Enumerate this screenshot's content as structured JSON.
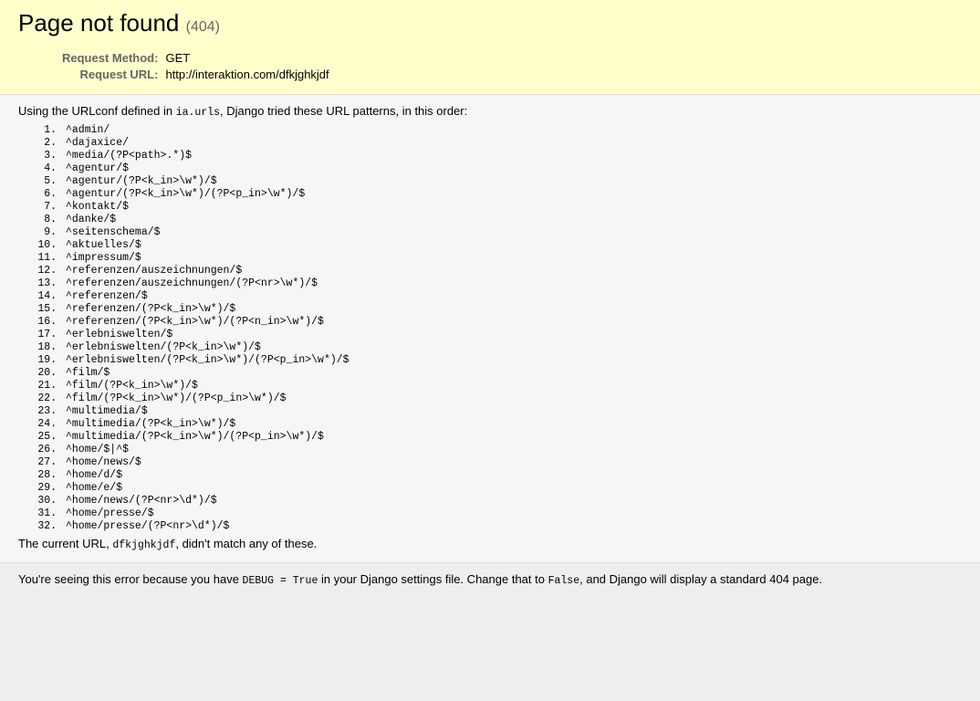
{
  "summary": {
    "title": "Page not found",
    "status_code": "(404)",
    "request_method_label": "Request Method:",
    "request_method": "GET",
    "request_url_label": "Request URL:",
    "request_url": "http://interaktion.com/dfkjghkjdf"
  },
  "info": {
    "intro_before": "Using the URLconf defined in ",
    "urlconf": "ia.urls",
    "intro_after": ", Django tried these URL patterns, in this order:",
    "patterns": [
      "^admin/",
      "^dajaxice/",
      "^media/(?P<path>.*)$",
      "^agentur/$",
      "^agentur/(?P<k_in>\\w*)/$",
      "^agentur/(?P<k_in>\\w*)/(?P<p_in>\\w*)/$",
      "^kontakt/$",
      "^danke/$",
      "^seitenschema/$",
      "^aktuelles/$",
      "^impressum/$",
      "^referenzen/auszeichnungen/$",
      "^referenzen/auszeichnungen/(?P<nr>\\w*)/$",
      "^referenzen/$",
      "^referenzen/(?P<k_in>\\w*)/$",
      "^referenzen/(?P<k_in>\\w*)/(?P<n_in>\\w*)/$",
      "^erlebniswelten/$",
      "^erlebniswelten/(?P<k_in>\\w*)/$",
      "^erlebniswelten/(?P<k_in>\\w*)/(?P<p_in>\\w*)/$",
      "^film/$",
      "^film/(?P<k_in>\\w*)/$",
      "^film/(?P<k_in>\\w*)/(?P<p_in>\\w*)/$",
      "^multimedia/$",
      "^multimedia/(?P<k_in>\\w*)/$",
      "^multimedia/(?P<k_in>\\w*)/(?P<p_in>\\w*)/$",
      "^home/$|^$",
      "^home/news/$",
      "^home/d/$",
      "^home/e/$",
      "^home/news/(?P<nr>\\d*)/$",
      "^home/presse/$",
      "^home/presse/(?P<nr>\\d*)/$"
    ],
    "current_before": "The current URL, ",
    "current_path": "dfkjghkjdf",
    "current_after": ", didn't match any of these."
  },
  "explanation": {
    "text_1": "You're seeing this error because you have ",
    "debug_code": "DEBUG = True",
    "text_2": " in your Django settings file. Change that to ",
    "false_code": "False",
    "text_3": ", and Django will display a standard 404 page."
  }
}
